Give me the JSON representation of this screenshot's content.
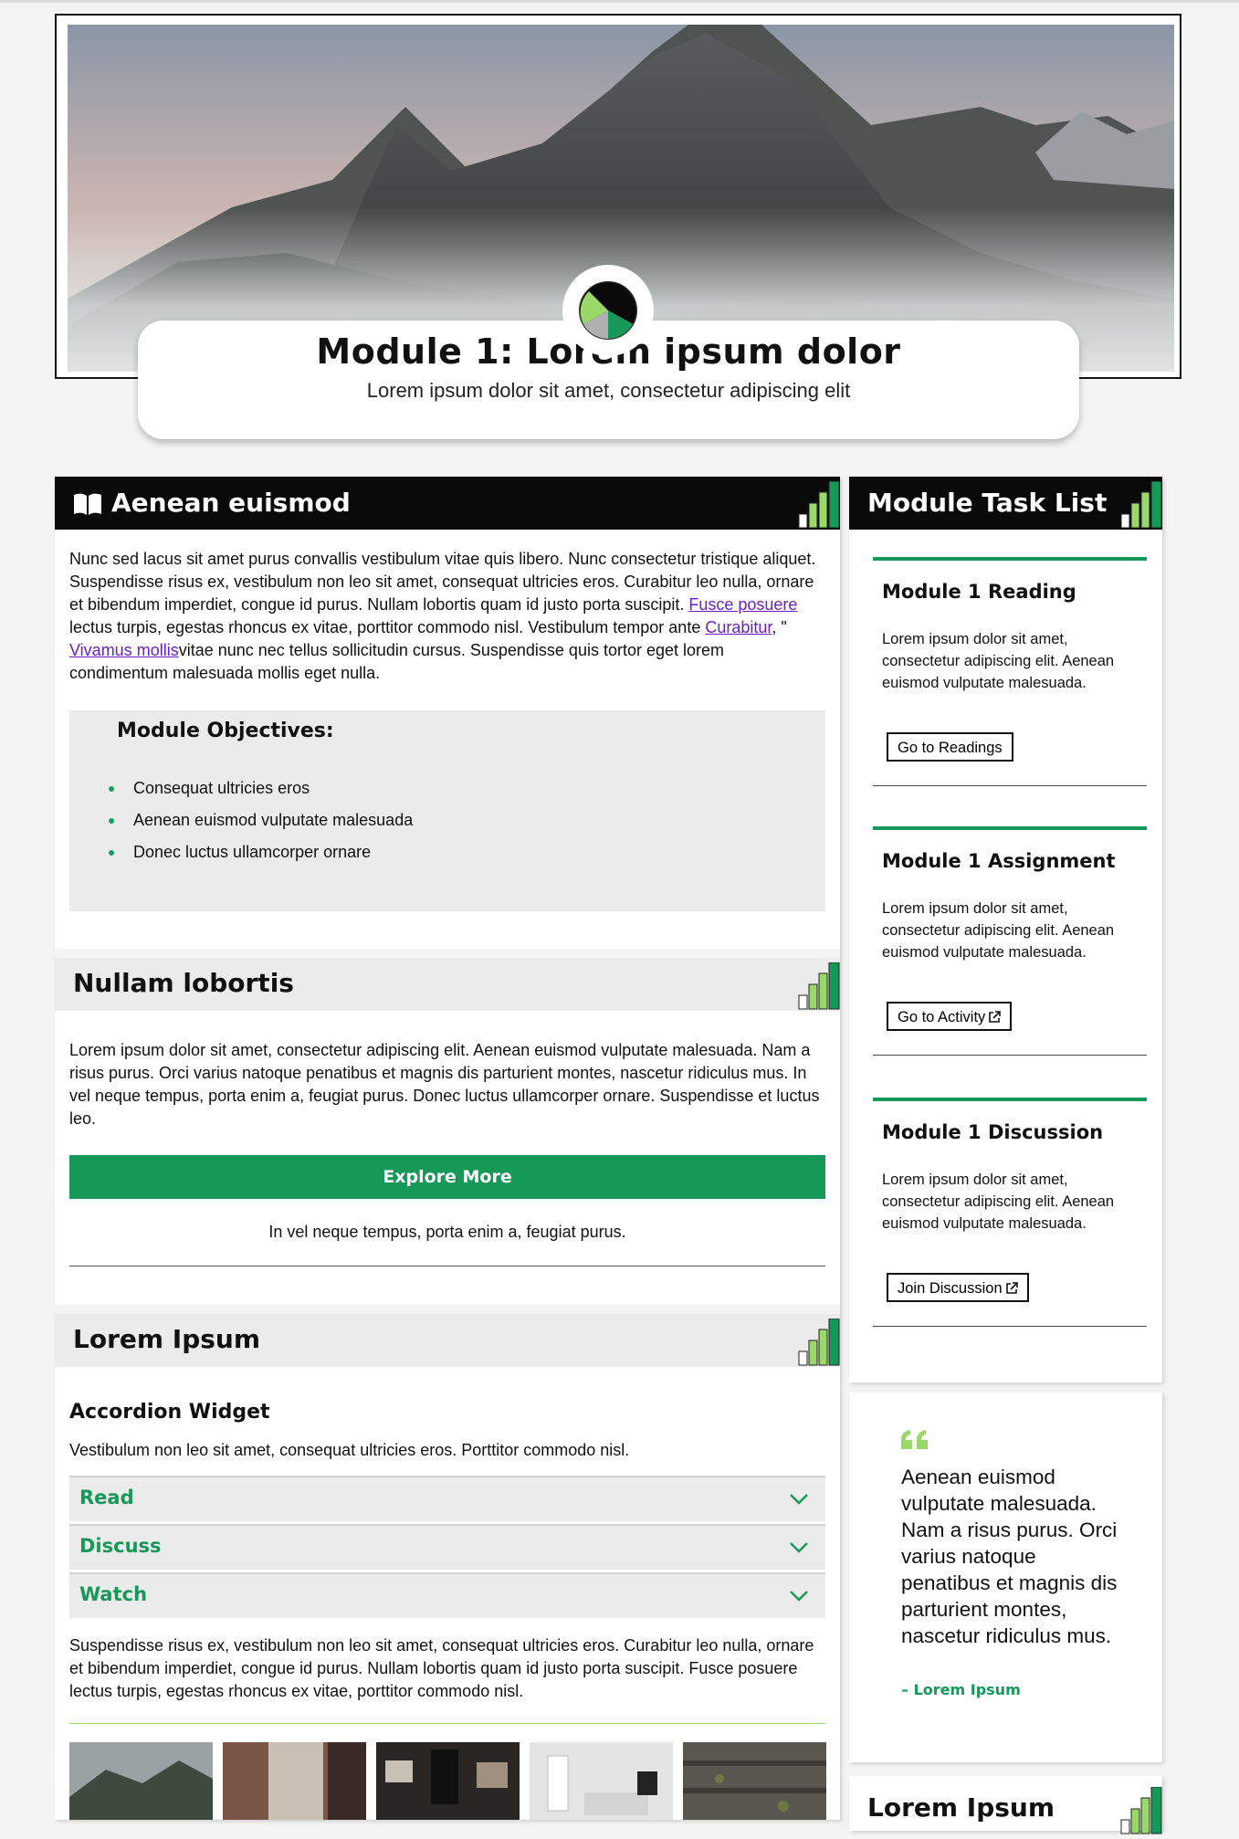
{
  "hero": {
    "title": "Module 1: Lorem ipsum dolor",
    "subtitle": "Lorem ipsum dolor sit amet, consectetur adipiscing elit"
  },
  "section1": {
    "title": "Aenean euismod",
    "para_a": "Nunc sed lacus sit amet purus convallis vestibulum vitae quis libero. Nunc consectetur tristique aliquet. Suspendisse risus ex, vestibulum non leo sit amet, consequat ultricies eros. Curabitur leo nulla, ornare et bibendum imperdiet, congue id purus. Nullam lobortis quam id justo porta suscipit. ",
    "link1": "Fusce posuere",
    "para_b": " lectus turpis, egestas rhoncus ex vitae, porttitor commodo nisl. Vestibulum tempor ante ",
    "link2": "Curabitur",
    "para_c": ", \" ",
    "link3": "Vivamus mollis",
    "para_d": "vitae nunc nec tellus sollicitudin cursus. Suspendisse quis tortor eget lorem condimentum malesuada mollis eget nulla.",
    "objectives_title": "Module Objectives:",
    "objectives": [
      "Consequat ultricies eros",
      "Aenean euismod vulputate malesuada",
      "Donec luctus ullamcorper ornare"
    ]
  },
  "section2": {
    "title": "Nullam lobortis",
    "body": "Lorem ipsum dolor sit amet, consectetur adipiscing elit. Aenean euismod vulputate malesuada. Nam a risus purus. Orci varius natoque penatibus et magnis dis parturient montes, nascetur ridiculus mus. In vel neque tempus, porta enim a, feugiat purus. Donec luctus ullamcorper ornare. Suspendisse et luctus leo.",
    "button": "Explore More",
    "caption": "In vel neque tempus, porta enim a, feugiat purus."
  },
  "section3": {
    "title": "Lorem Ipsum",
    "widget_title": "Accordion Widget",
    "widget_intro": "Vestibulum non leo sit amet, consequat ultricies eros. Porttitor commodo nisl.",
    "accordion": [
      "Read",
      "Discuss",
      "Watch"
    ],
    "after": "Suspendisse risus ex, vestibulum non leo sit amet, consequat ultricies eros. Curabitur leo nulla, ornare et bibendum imperdiet, congue id purus. Nullam lobortis quam id justo porta suscipit. Fusce posuere lectus turpis, egestas rhoncus ex vitae, porttitor commodo nisl."
  },
  "sidebar": {
    "title": "Module Task List",
    "tasks": [
      {
        "title": "Module 1 Reading",
        "desc": "Lorem ipsum dolor sit amet, consectetur adipiscing elit. Aenean euismod vulputate malesuada.",
        "button": "Go to Readings"
      },
      {
        "title": "Module 1 Assignment",
        "desc": "Lorem ipsum dolor sit amet, consectetur adipiscing elit. Aenean euismod vulputate malesuada.",
        "button": "Go to Activity"
      },
      {
        "title": "Module 1 Discussion",
        "desc": "Lorem ipsum dolor sit amet, consectetur adipiscing elit. Aenean euismod vulputate malesuada.",
        "button": "Join Discussion"
      }
    ]
  },
  "quote": {
    "text": "Aenean euismod vulputate malesuada. Nam a risus purus. Orci varius natoque penatibus et magnis dis parturient montes, nascetur ridiculus mus.",
    "author": "– Lorem Ipsum"
  },
  "bottom_card": {
    "title": "Lorem Ipsum"
  },
  "colors": {
    "accent": "#169858",
    "light_green": "#9ad86a",
    "link": "#6a1fc8",
    "header": "#0a0a0a"
  },
  "icons": {
    "book": "book-open-icon",
    "bars": "signal-bars-icon",
    "chevron": "chevron-down-icon",
    "external": "external-link-icon",
    "quote": "quote-icon"
  }
}
